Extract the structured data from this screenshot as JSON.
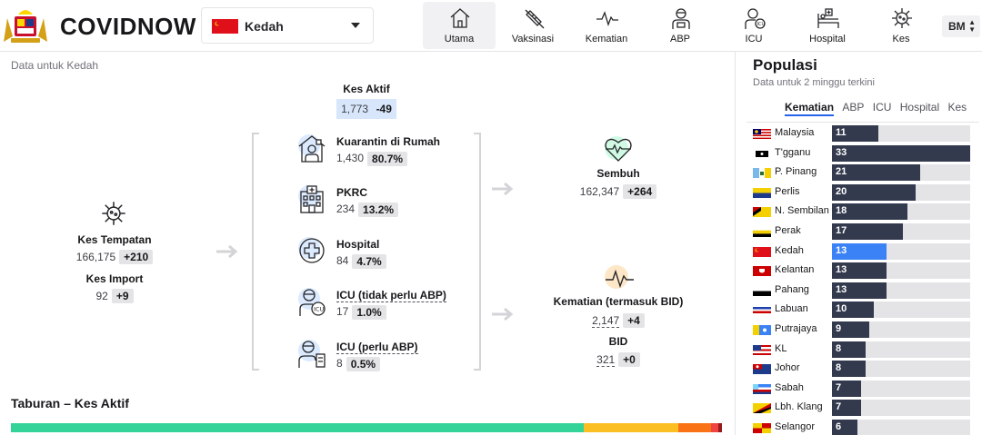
{
  "header": {
    "brand": "COVIDNOW",
    "state_select": {
      "value": "Kedah"
    },
    "nav": [
      {
        "id": "utama",
        "label": "Utama",
        "icon": "home-icon",
        "active": true
      },
      {
        "id": "vaksinasi",
        "label": "Vaksinasi",
        "icon": "syringe-icon"
      },
      {
        "id": "kematian",
        "label": "Kematian",
        "icon": "heartbeat-icon"
      },
      {
        "id": "abp",
        "label": "ABP",
        "icon": "ppe-icon"
      },
      {
        "id": "icu",
        "label": "ICU",
        "icon": "icu-icon"
      },
      {
        "id": "hospital",
        "label": "Hospital",
        "icon": "hospital-bed-icon"
      },
      {
        "id": "kes",
        "label": "Kes",
        "icon": "virus-icon"
      }
    ],
    "lang": "BM"
  },
  "main": {
    "subtitle": "Data untuk Kedah",
    "kes_aktif": {
      "label": "Kes Aktif",
      "value": "1,773",
      "delta": "-49"
    },
    "kes_tempatan": {
      "label": "Kes Tempatan",
      "value": "166,175",
      "delta": "+210"
    },
    "kes_import": {
      "label": "Kes Import",
      "value": "92",
      "delta": "+9"
    },
    "breakdown": [
      {
        "label": "Kuarantin di Rumah",
        "value": "1,430",
        "pct": "80.7%",
        "icon": "home-quarantine-icon"
      },
      {
        "label": "PKRC",
        "value": "234",
        "pct": "13.2%",
        "icon": "pkrc-building-icon"
      },
      {
        "label": "Hospital",
        "value": "84",
        "pct": "4.7%",
        "icon": "hospital-cross-icon"
      },
      {
        "label": "ICU (tidak perlu ABP)",
        "value": "17",
        "pct": "1.0%",
        "icon": "icu-doctor-icon"
      },
      {
        "label": "ICU (perlu ABP)",
        "value": "8",
        "pct": "0.5%",
        "icon": "ventilator-patient-icon"
      }
    ],
    "sembuh": {
      "label": "Sembuh",
      "value": "162,347",
      "delta": "+264"
    },
    "kematian": {
      "label": "Kematian (termasuk BID)",
      "value": "2,147",
      "delta": "+4"
    },
    "bid": {
      "label": "BID",
      "value": "321",
      "delta": "+0"
    },
    "distribution": {
      "title": "Taburan – Kes Aktif",
      "segments": [
        {
          "pct": 80.7,
          "color": "#34d399"
        },
        {
          "pct": 13.2,
          "color": "#fbbf24"
        },
        {
          "pct": 4.7,
          "color": "#f97316"
        },
        {
          "pct": 1.0,
          "color": "#ef4444"
        },
        {
          "pct": 0.5,
          "color": "#991b1b"
        }
      ]
    }
  },
  "ranking": {
    "title": "Populasi",
    "subtitle": "Data untuk 2 minggu terkini",
    "tabs": [
      "Kematian",
      "ABP",
      "ICU",
      "Hospital",
      "Kes"
    ],
    "active_tab": "Kematian",
    "max": 33,
    "rows": [
      {
        "name": "Malaysia",
        "value": 11,
        "flag": "malaysia"
      },
      {
        "name": "T'gganu",
        "value": 33,
        "flag": "terengganu"
      },
      {
        "name": "P. Pinang",
        "value": 21,
        "flag": "penang"
      },
      {
        "name": "Perlis",
        "value": 20,
        "flag": "perlis"
      },
      {
        "name": "N. Sembilan",
        "value": 18,
        "flag": "nsembilan"
      },
      {
        "name": "Perak",
        "value": 17,
        "flag": "perak"
      },
      {
        "name": "Kedah",
        "value": 13,
        "flag": "kedah",
        "highlight": true
      },
      {
        "name": "Kelantan",
        "value": 13,
        "flag": "kelantan"
      },
      {
        "name": "Pahang",
        "value": 13,
        "flag": "pahang"
      },
      {
        "name": "Labuan",
        "value": 10,
        "flag": "labuan"
      },
      {
        "name": "Putrajaya",
        "value": 9,
        "flag": "putrajaya"
      },
      {
        "name": "KL",
        "value": 8,
        "flag": "kl"
      },
      {
        "name": "Johor",
        "value": 8,
        "flag": "johor"
      },
      {
        "name": "Sabah",
        "value": 7,
        "flag": "sabah"
      },
      {
        "name": "Lbh. Klang",
        "value": 7,
        "flag": "klang"
      },
      {
        "name": "Selangor",
        "value": 6,
        "flag": "selangor"
      }
    ]
  }
}
